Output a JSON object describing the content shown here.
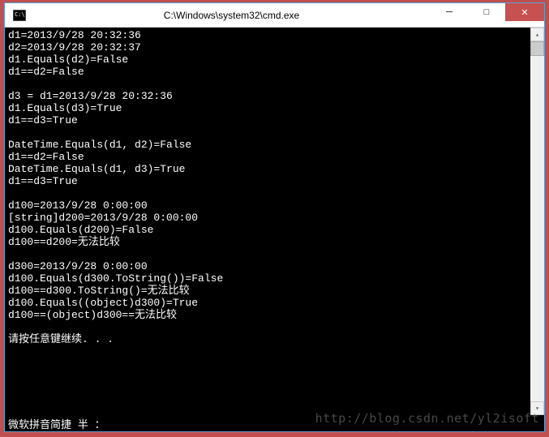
{
  "window": {
    "title": "C:\\Windows\\system32\\cmd.exe",
    "minimize": "─",
    "maximize": "□",
    "close": "✕"
  },
  "console": {
    "lines": [
      "d1=2013/9/28 20:32:36",
      "d2=2013/9/28 20:32:37",
      "d1.Equals(d2)=False",
      "d1==d2=False",
      "",
      "d3 = d1=2013/9/28 20:32:36",
      "d1.Equals(d3)=True",
      "d1==d3=True",
      "",
      "DateTime.Equals(d1, d2)=False",
      "d1==d2=False",
      "DateTime.Equals(d1, d3)=True",
      "d1==d3=True",
      "",
      "d100=2013/9/28 0:00:00",
      "[string]d200=2013/9/28 0:00:00",
      "d100.Equals(d200)=False",
      "d100==d200=无法比较",
      "",
      "d300=2013/9/28 0:00:00",
      "d100.Equals(d300.ToString())=False",
      "d100==d300.ToString()=无法比较",
      "d100.Equals((object)d300)=True",
      "d100==(object)d300==无法比较",
      "",
      "请按任意键继续. . ."
    ]
  },
  "ime": {
    "text": "微软拼音简捷 半 ："
  },
  "watermark": "http://blog.csdn.net/yl2isoft"
}
